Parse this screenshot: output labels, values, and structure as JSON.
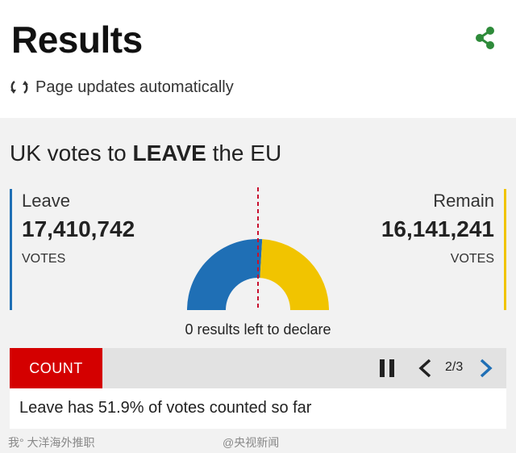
{
  "header": {
    "title": "Results",
    "updates_text": "Page updates automatically"
  },
  "panel": {
    "headline_prefix": "UK votes to ",
    "headline_bold": "LEAVE",
    "headline_suffix": " the EU",
    "leave": {
      "name": "Leave",
      "votes": "17,410,742",
      "unit": "VOTES",
      "color": "#1f6fb5"
    },
    "remain": {
      "name": "Remain",
      "votes": "16,141,241",
      "unit": "VOTES",
      "color": "#f1c400"
    },
    "left_to_declare": "0 results left to declare",
    "gauge": {
      "leave_share": 51.9,
      "remain_share": 48.1
    }
  },
  "ticker": {
    "tab_label": "COUNT",
    "pager": "2/3",
    "message": "Leave has 51.9% of votes counted so far"
  },
  "watermarks": {
    "left": "我° 大洋海外推职",
    "center": "@央视新闻"
  },
  "colors": {
    "count_tab": "#d40000",
    "share_icon": "#2e8b3a"
  }
}
